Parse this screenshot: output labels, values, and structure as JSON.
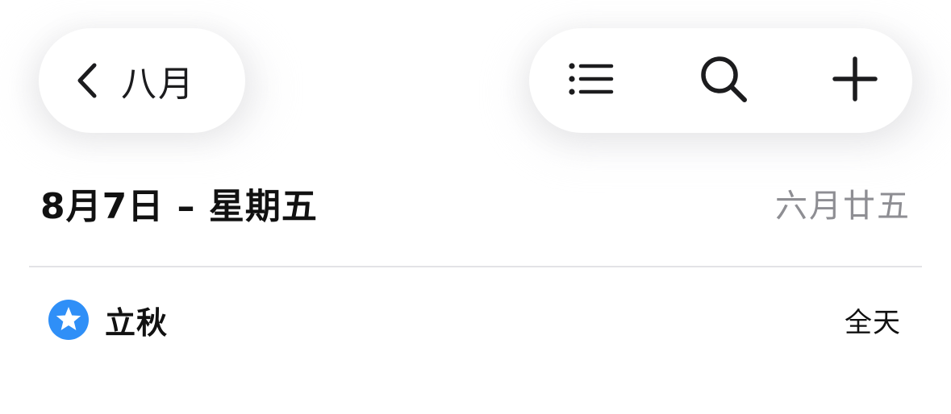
{
  "nav": {
    "back_label": "八月",
    "back_icon": "chevron-left-icon",
    "actions": [
      {
        "name": "list-view-button",
        "icon": "list-icon"
      },
      {
        "name": "search-button",
        "icon": "search-icon"
      },
      {
        "name": "add-event-button",
        "icon": "plus-icon"
      }
    ]
  },
  "day": {
    "date_title": "8月7日 – 星期五",
    "lunar_date": "六月廿五"
  },
  "events": [
    {
      "title": "立秋",
      "time": "全天",
      "icon": "star-circle-icon",
      "color": "#2f8ff7"
    }
  ]
}
